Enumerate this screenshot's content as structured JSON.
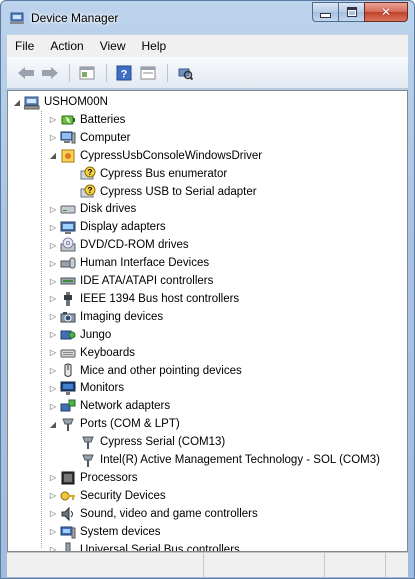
{
  "window": {
    "title": "Device Manager",
    "icon": "device-manager-icon"
  },
  "menubar": {
    "items": [
      "File",
      "Action",
      "View",
      "Help"
    ]
  },
  "toolbar": {
    "buttons": [
      "back-arrow-icon",
      "forward-arrow-icon",
      "properties-icon",
      "help-icon",
      "show-hidden-icon",
      "scan-hardware-icon"
    ]
  },
  "tree": {
    "root": "USHOM00N",
    "items": [
      {
        "label": "Batteries",
        "icon": "battery-icon",
        "expanded": false
      },
      {
        "label": "Computer",
        "icon": "computer-icon",
        "expanded": false
      },
      {
        "label": "CypressUsbConsoleWindowsDriver",
        "icon": "warning-device-icon",
        "expanded": true,
        "children": [
          {
            "label": "Cypress Bus enumerator",
            "icon": "unknown-device-icon"
          },
          {
            "label": "Cypress USB to Serial adapter",
            "icon": "unknown-device-icon"
          }
        ]
      },
      {
        "label": "Disk drives",
        "icon": "disk-drive-icon",
        "expanded": false
      },
      {
        "label": "Display adapters",
        "icon": "display-adapter-icon",
        "expanded": false
      },
      {
        "label": "DVD/CD-ROM drives",
        "icon": "dvd-drive-icon",
        "expanded": false
      },
      {
        "label": "Human Interface Devices",
        "icon": "hid-icon",
        "expanded": false
      },
      {
        "label": "IDE ATA/ATAPI controllers",
        "icon": "ide-controller-icon",
        "expanded": false
      },
      {
        "label": "IEEE 1394 Bus host controllers",
        "icon": "ieee1394-icon",
        "expanded": false
      },
      {
        "label": "Imaging devices",
        "icon": "imaging-device-icon",
        "expanded": false
      },
      {
        "label": "Jungo",
        "icon": "jungo-icon",
        "expanded": false
      },
      {
        "label": "Keyboards",
        "icon": "keyboard-icon",
        "expanded": false
      },
      {
        "label": "Mice and other pointing devices",
        "icon": "mouse-icon",
        "expanded": false
      },
      {
        "label": "Monitors",
        "icon": "monitor-icon",
        "expanded": false
      },
      {
        "label": "Network adapters",
        "icon": "network-adapter-icon",
        "expanded": false
      },
      {
        "label": "Ports (COM & LPT)",
        "icon": "port-icon",
        "expanded": true,
        "children": [
          {
            "label": "Cypress Serial (COM13)",
            "icon": "port-icon"
          },
          {
            "label": "Intel(R) Active Management Technology - SOL (COM3)",
            "icon": "port-icon"
          }
        ]
      },
      {
        "label": "Processors",
        "icon": "processor-icon",
        "expanded": false
      },
      {
        "label": "Security Devices",
        "icon": "security-device-icon",
        "expanded": false
      },
      {
        "label": "Sound, video and game controllers",
        "icon": "sound-icon",
        "expanded": false
      },
      {
        "label": "System devices",
        "icon": "system-device-icon",
        "expanded": false
      },
      {
        "label": "Universal Serial Bus controllers",
        "icon": "usb-icon",
        "expanded": false
      }
    ]
  },
  "colors": {
    "title_gradient_top": "#bcd3ec",
    "close_button": "#c2402b",
    "tree_background": "#ffffff"
  }
}
